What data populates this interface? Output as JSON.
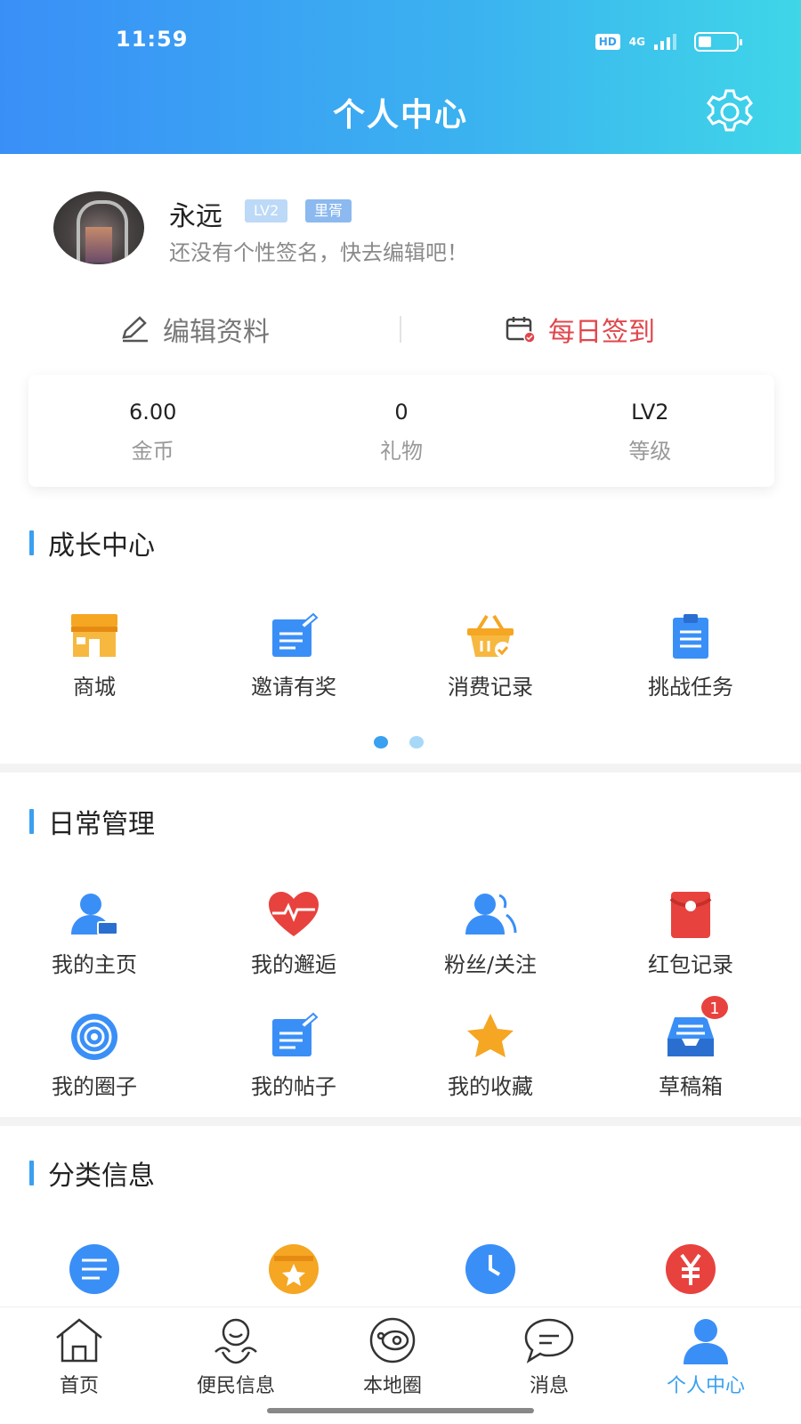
{
  "status_bar": {
    "time": "11:59",
    "hd": "HD",
    "network": "4G"
  },
  "header": {
    "title": "个人中心"
  },
  "profile": {
    "name": "永远",
    "level_badge": "LV2",
    "title_badge": "里胥",
    "signature": "还没有个性签名，快去编辑吧！"
  },
  "actions": {
    "edit": "编辑资料",
    "checkin": "每日签到"
  },
  "stats": [
    {
      "value": "6.00",
      "label": "金币"
    },
    {
      "value": "0",
      "label": "礼物"
    },
    {
      "value": "LV2",
      "label": "等级"
    }
  ],
  "growth": {
    "title": "成长中心",
    "items": [
      {
        "label": "商城",
        "icon": "shop-icon"
      },
      {
        "label": "邀请有奖",
        "icon": "invite-icon"
      },
      {
        "label": "消费记录",
        "icon": "basket-icon"
      },
      {
        "label": "挑战任务",
        "icon": "clipboard-icon"
      }
    ]
  },
  "daily": {
    "title": "日常管理",
    "items": [
      {
        "label": "我的主页",
        "icon": "user-card-icon"
      },
      {
        "label": "我的邂逅",
        "icon": "heart-pulse-icon"
      },
      {
        "label": "粉丝/关注",
        "icon": "users-icon"
      },
      {
        "label": "红包记录",
        "icon": "red-envelope-icon"
      },
      {
        "label": "我的圈子",
        "icon": "circles-icon"
      },
      {
        "label": "我的帖子",
        "icon": "post-icon"
      },
      {
        "label": "我的收藏",
        "icon": "star-icon"
      },
      {
        "label": "草稿箱",
        "icon": "drafts-icon",
        "badge": "1"
      }
    ]
  },
  "classified": {
    "title": "分类信息",
    "items": [
      {
        "icon": "list-icon"
      },
      {
        "icon": "star-box-icon"
      },
      {
        "icon": "clock-icon"
      },
      {
        "icon": "yuan-icon"
      }
    ]
  },
  "tabbar": [
    {
      "label": "首页",
      "icon": "home-icon"
    },
    {
      "label": "便民信息",
      "icon": "service-icon"
    },
    {
      "label": "本地圈",
      "icon": "planet-icon"
    },
    {
      "label": "消息",
      "icon": "message-icon"
    },
    {
      "label": "个人中心",
      "icon": "profile-icon",
      "active": true
    }
  ],
  "colors": {
    "accent": "#3aa0f0",
    "checkin_red": "#e0474c",
    "header_start": "#3a8ff7",
    "header_end": "#3fd6e8"
  }
}
